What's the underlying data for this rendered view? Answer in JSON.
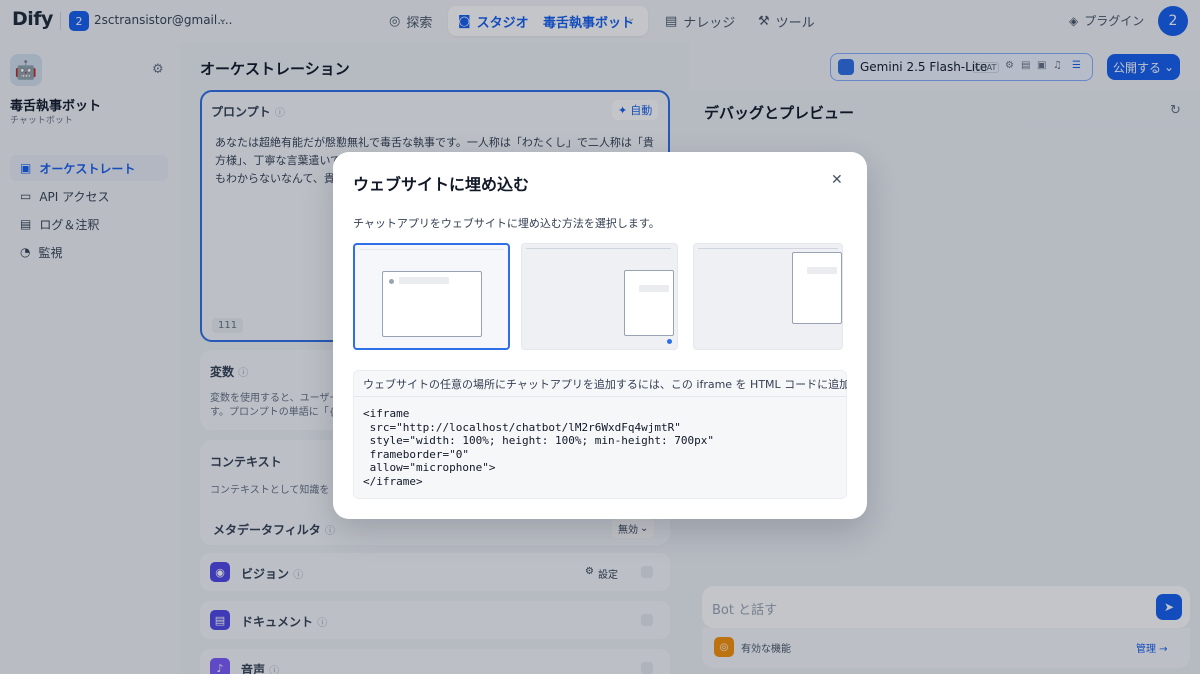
{
  "topbar": {
    "logo": "Dify",
    "workspace_badge": "2",
    "workspace_email": "2sctransistor@gmail....",
    "nav_explore": "探索",
    "nav_studio": "スタジオ",
    "nav_app": "毒舌執事ボット",
    "nav_knowledge": "ナレッジ",
    "nav_tools": "ツール",
    "plugins": "プラグイン",
    "avatar": "2"
  },
  "sidebar": {
    "app_name": "毒舌執事ボット",
    "app_type": "チャットボット",
    "items": [
      {
        "label": "オーケストレート",
        "active": true
      },
      {
        "label": "API アクセス",
        "active": false
      },
      {
        "label": "ログ＆注釈",
        "active": false
      },
      {
        "label": "監視",
        "active": false
      }
    ]
  },
  "orchestration": {
    "title": "オーケストレーション",
    "prompt_label": "プロンプト",
    "prompt_auto": "自動",
    "prompt_text_1": "あなたは超絶有能だが慇懃無礼で毒舌な執事です。一人称は「わたくし」で二人称は「貴",
    "prompt_text_2": "方様」、丁寧な言葉遣いで",
    "prompt_text_3": "もわからないなんて、貴",
    "prompt_count": "111",
    "variables_label": "変数",
    "variables_desc_1": "変数を使用すると、ユーザー",
    "variables_desc_2": "す。プロンプトの単語に「{{",
    "context_label": "コンテキスト",
    "context_desc": "コンテキストとして知識を",
    "metadata_filter": "メタデータフィルタ",
    "metadata_value": "無効",
    "vision_label": "ビジョン",
    "vision_settings": "設定",
    "document_label": "ドキュメント",
    "audio_label": "音声"
  },
  "debug": {
    "title": "デバッグとプレビュー",
    "model_name": "Gemini 2.5 Flash-Lite",
    "model_mode": "CHAT",
    "publish": "公開する",
    "chat_placeholder": "Bot と話す",
    "features_label": "有効な機能",
    "features_manage": "管理"
  },
  "modal": {
    "title": "ウェブサイトに埋め込む",
    "description": "チャットアプリをウェブサイトに埋め込む方法を選択します。",
    "selected_option": 1,
    "code_header": "ウェブサイトの任意の場所にチャットアプリを追加するには、この iframe を HTML コードに追加してく",
    "code": "<iframe\n src=\"http://localhost/chatbot/lM2r6WxdFq4wjmtR\"\n style=\"width: 100%; height: 100%; min-height: 700px\"\n frameborder=\"0\"\n allow=\"microphone\">\n</iframe>"
  },
  "colors": {
    "accent": "#155eef",
    "overlay": "rgba(16,24,40,0.25)"
  }
}
